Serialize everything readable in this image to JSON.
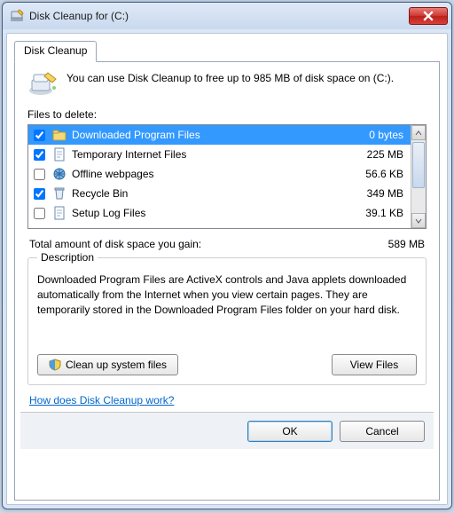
{
  "window": {
    "title": "Disk Cleanup for  (C:)"
  },
  "tab": {
    "label": "Disk Cleanup"
  },
  "intro": "You can use Disk Cleanup to free up to 985 MB of disk space on (C:).",
  "list": {
    "label": "Files to delete:",
    "items": [
      {
        "name": "Downloaded Program Files",
        "size": "0 bytes",
        "checked": true,
        "selected": true,
        "icon": "folder"
      },
      {
        "name": "Temporary Internet Files",
        "size": "225 MB",
        "checked": true,
        "selected": false,
        "icon": "page"
      },
      {
        "name": "Offline webpages",
        "size": "56.6 KB",
        "checked": false,
        "selected": false,
        "icon": "globe"
      },
      {
        "name": "Recycle Bin",
        "size": "349 MB",
        "checked": true,
        "selected": false,
        "icon": "bin"
      },
      {
        "name": "Setup Log Files",
        "size": "39.1 KB",
        "checked": false,
        "selected": false,
        "icon": "page"
      }
    ]
  },
  "total": {
    "label": "Total amount of disk space you gain:",
    "value": "589 MB"
  },
  "description": {
    "legend": "Description",
    "text": "Downloaded Program Files are ActiveX controls and Java applets downloaded automatically from the Internet when you view certain pages. They are temporarily stored in the Downloaded Program Files folder on your hard disk."
  },
  "buttons": {
    "cleanup": "Clean up system files",
    "view": "View Files",
    "ok": "OK",
    "cancel": "Cancel"
  },
  "link": "How does Disk Cleanup work?"
}
